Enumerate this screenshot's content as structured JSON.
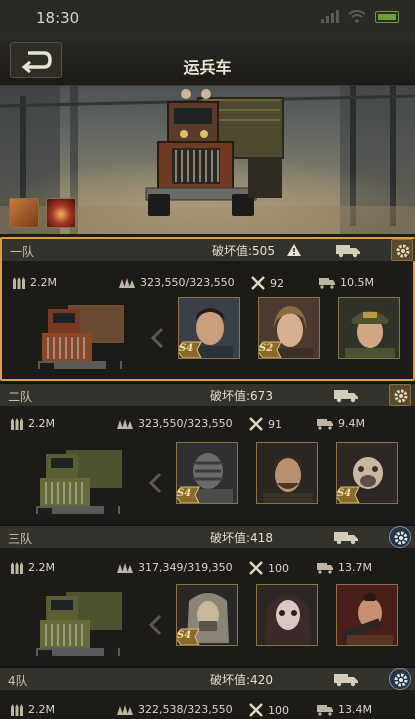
{
  "status": {
    "time": "18:30"
  },
  "header": {
    "title": "运兵车"
  },
  "squads": [
    {
      "name": "一队",
      "damage": "破坏值:505",
      "ammo": "2.2M",
      "hp": "323,550/323,550",
      "repair": "92",
      "load": "10.5M",
      "heroes": [
        {
          "badge": "S4"
        },
        {
          "badge": "S2"
        },
        {
          "badge": ""
        }
      ]
    },
    {
      "name": "二队",
      "damage": "破坏值:673",
      "ammo": "2.2M",
      "hp": "323,550/323,550",
      "repair": "91",
      "load": "9.4M",
      "heroes": [
        {
          "badge": "S4"
        },
        {
          "badge": ""
        },
        {
          "badge": "S4"
        }
      ]
    },
    {
      "name": "三队",
      "damage": "破坏值:418",
      "ammo": "2.2M",
      "hp": "317,349/319,350",
      "repair": "100",
      "load": "13.7M",
      "heroes": [
        {
          "badge": "S4"
        },
        {
          "badge": ""
        },
        {
          "badge": ""
        }
      ]
    },
    {
      "name": "4队",
      "damage": "破坏值:420",
      "ammo": "2.2M",
      "hp": "322,538/323,550",
      "repair": "100",
      "load": "13.4M",
      "heroes": []
    }
  ],
  "colors": {
    "selected_border": "#d8a040",
    "accent": "#b8a070"
  },
  "icons": [
    "back-icon",
    "warning-icon",
    "truck-icon",
    "gear-icon",
    "ammo-icon",
    "armor-icon",
    "wrench-icon",
    "cargo-icon",
    "chevron-left-icon"
  ]
}
